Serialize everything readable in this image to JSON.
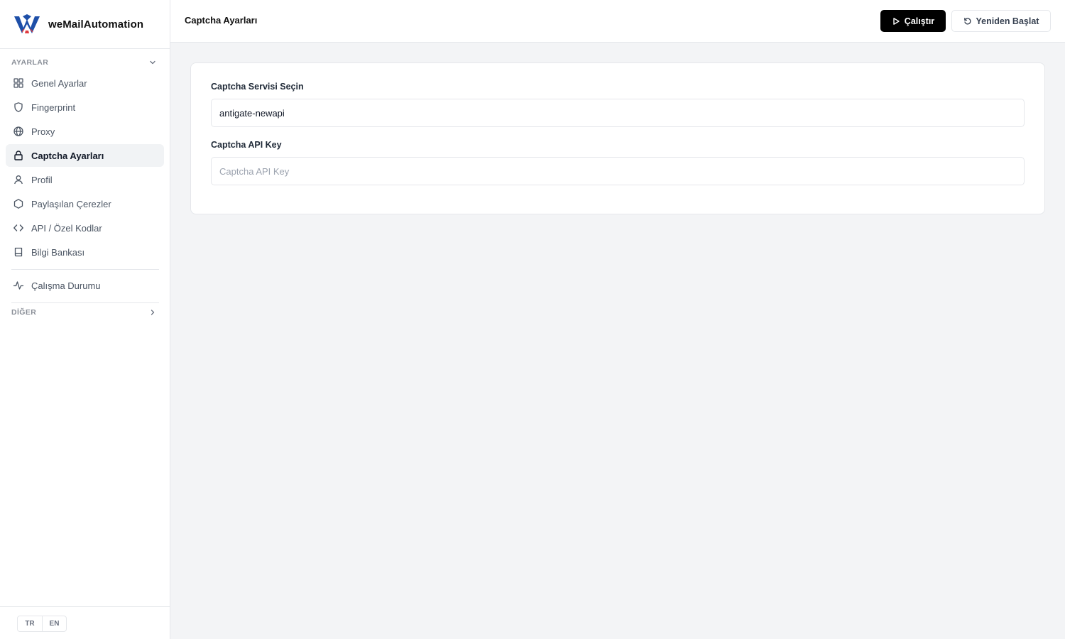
{
  "brand": {
    "name": "weMailAutomation"
  },
  "sidebar": {
    "section_settings": "AYARLAR",
    "items": [
      {
        "label": "Genel Ayarlar",
        "icon": "grid-icon"
      },
      {
        "label": "Fingerprint",
        "icon": "shield-icon"
      },
      {
        "label": "Proxy",
        "icon": "globe-icon"
      },
      {
        "label": "Captcha Ayarları",
        "icon": "lock-icon",
        "active": true
      },
      {
        "label": "Profil",
        "icon": "user-icon"
      },
      {
        "label": "Paylaşılan Çerezler",
        "icon": "hexagon-icon"
      },
      {
        "label": "API / Özel Kodlar",
        "icon": "code-icon"
      },
      {
        "label": "Bilgi Bankası",
        "icon": "book-icon"
      }
    ],
    "status_item": {
      "label": "Çalışma Durumu",
      "icon": "activity-icon"
    },
    "section_other": "DİĞER",
    "languages": [
      "TR",
      "EN"
    ]
  },
  "header": {
    "title": "Captcha Ayarları",
    "run_label": "Çalıştır",
    "restart_label": "Yeniden Başlat"
  },
  "form": {
    "service_label": "Captcha Servisi Seçin",
    "service_value": "antigate-newapi",
    "api_key_label": "Captcha API Key",
    "api_key_placeholder": "Captcha API Key",
    "api_key_value": ""
  },
  "colors": {
    "accent": "#000000",
    "active_bg": "#f1f3f5",
    "logo_blue": "#1e4fa8",
    "logo_red": "#e03a3e"
  }
}
